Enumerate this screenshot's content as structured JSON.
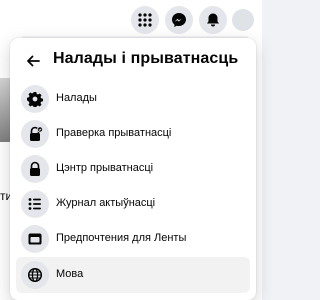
{
  "header": {
    "icons": [
      "grid-icon",
      "messenger-icon",
      "notifications-icon",
      "account-icon"
    ]
  },
  "background": {
    "left_fragment": "тир"
  },
  "panel": {
    "title": "Налады і прыватнасць",
    "back_icon": "arrow-left-icon",
    "items": [
      {
        "label": "Налады",
        "icon": "gear-icon"
      },
      {
        "label": "Праверка прыватнасці",
        "icon": "lock-check-icon"
      },
      {
        "label": "Цэнтр прыватнасці",
        "icon": "lock-icon"
      },
      {
        "label": "Журнал актыўнасці",
        "icon": "list-icon"
      },
      {
        "label": "Предпочтения для Ленты",
        "icon": "feed-icon"
      },
      {
        "label": "Мова",
        "icon": "globe-icon"
      }
    ],
    "active_item": "Мова"
  },
  "colors": {
    "icon_bg": "#e4e6eb",
    "hover_bg": "#f2f2f2",
    "text": "#050505",
    "page_bg": "#f0f2f5"
  }
}
